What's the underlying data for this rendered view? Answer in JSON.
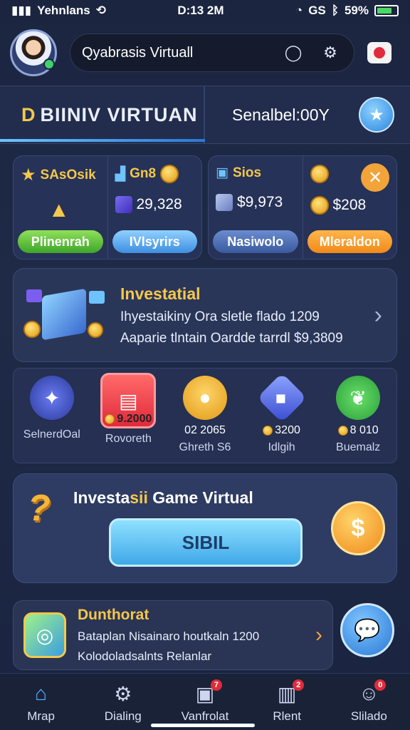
{
  "status_bar": {
    "carrier": "Yehnlans",
    "time": "D:13 2M",
    "network": "GS",
    "battery": "59%"
  },
  "header": {
    "search_title": "Qyabrasis Virtuall"
  },
  "banner": {
    "left_prefix": "D",
    "left_text": "BIINIV VIRTUAN",
    "right_text": "Senalbel:00Y"
  },
  "cards": [
    {
      "title": "SAsOsik",
      "value": "",
      "button": "Plinenrah"
    },
    {
      "title": "Gn8",
      "value": "29,328",
      "button": "IVlsyrirs"
    },
    {
      "title": "Sios",
      "value": "$9,973",
      "button": "Nasiwolo"
    },
    {
      "title": "",
      "value": "$208",
      "button": "Mleraldon"
    }
  ],
  "promo": {
    "title": "Investatial",
    "line1": "Ihyestaikiny Ora sletle flado 1209",
    "line2": "Aaparie tlntain Oardde tarrdl $9,3809"
  },
  "games": [
    {
      "prize": "",
      "name": "SelnerdOal"
    },
    {
      "prize": "9.2000",
      "name": "Rovoreth"
    },
    {
      "prize": "02 2065",
      "name": "Ghreth S6"
    },
    {
      "prize": "3200",
      "name": "Idlgih"
    },
    {
      "prize": "8 010",
      "name": "Buemalz"
    }
  ],
  "invest": {
    "title_prefix": "Investa",
    "title_hl": "sii",
    "title_suffix": " Game Virtual",
    "button": "SIBIL"
  },
  "news": {
    "title": "Dunthorat",
    "line1": "Bataplan Nisainaro houtkaln 1200",
    "line2": "Kolodoladsalnts Relanlar"
  },
  "nav": [
    {
      "label": "Mrap",
      "active": true,
      "badge": ""
    },
    {
      "label": "Dialing",
      "active": false,
      "badge": ""
    },
    {
      "label": "Vanfrolat",
      "active": false,
      "badge": "7"
    },
    {
      "label": "Rlent",
      "active": false,
      "badge": "2"
    },
    {
      "label": "Slilado",
      "active": false,
      "badge": "0"
    }
  ],
  "colors": {
    "accent_gold": "#f4c84c",
    "accent_blue": "#3fa8e8",
    "background": "#1e2a47"
  }
}
